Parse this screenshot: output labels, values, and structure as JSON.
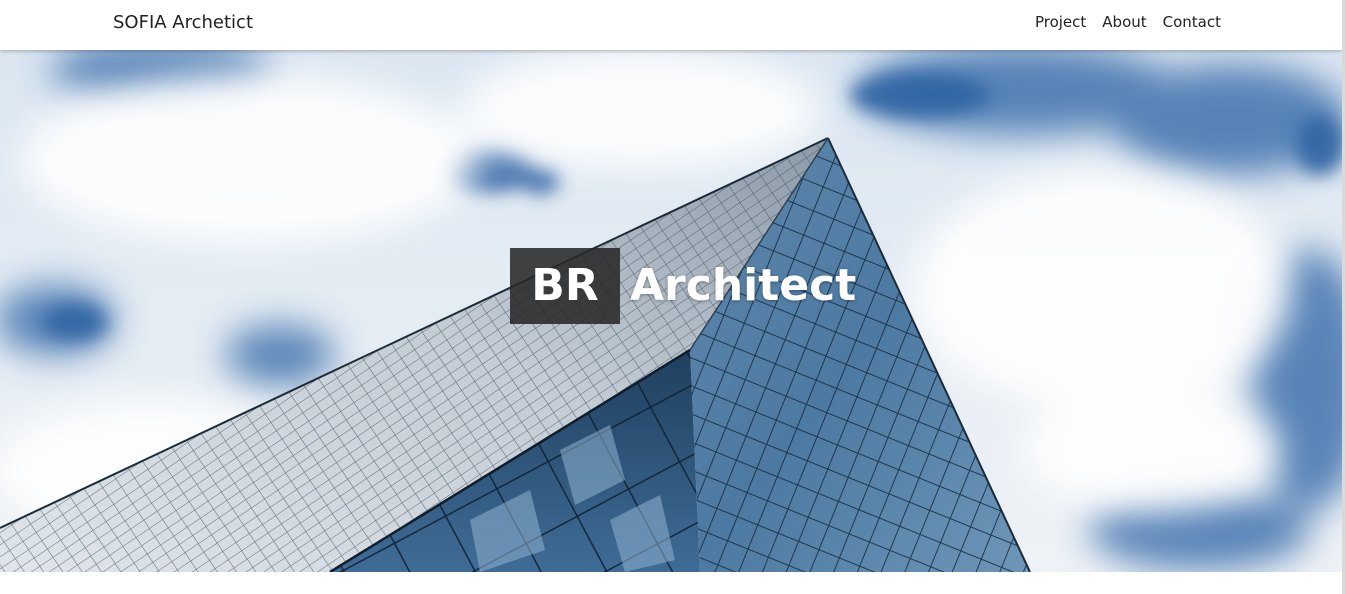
{
  "navbar": {
    "brand": "SOFIA Archetict",
    "links": [
      "Project",
      "About",
      "Contact"
    ]
  },
  "hero": {
    "title_boxed": "BR",
    "title_rest": "Architect"
  },
  "colors": {
    "navbar_bg": "#ffffff",
    "text": "#222222",
    "title_box_bg": "#282828",
    "sky_blue": "#3d6fa8",
    "glass_dark": "#2a4a6a"
  },
  "icons": {
    "hero_image": "glass-skyscraper-against-cloudy-sky"
  }
}
